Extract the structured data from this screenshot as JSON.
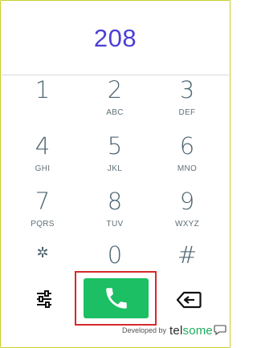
{
  "display": {
    "number": "208"
  },
  "keys": [
    {
      "digit": "1",
      "letters": ""
    },
    {
      "digit": "2",
      "letters": "ABC"
    },
    {
      "digit": "3",
      "letters": "DEF"
    },
    {
      "digit": "4",
      "letters": "GHI"
    },
    {
      "digit": "5",
      "letters": "JKL"
    },
    {
      "digit": "6",
      "letters": "MNO"
    },
    {
      "digit": "7",
      "letters": "PQRS"
    },
    {
      "digit": "8",
      "letters": "TUV"
    },
    {
      "digit": "9",
      "letters": "WXYZ"
    },
    {
      "digit": "✲",
      "letters": ""
    },
    {
      "digit": "0",
      "letters": ""
    },
    {
      "digit": "#",
      "letters": ""
    }
  ],
  "controls": {
    "settings_icon": "sliders-icon",
    "call_icon": "phone-icon",
    "backspace_icon": "backspace-icon"
  },
  "footer": {
    "developed_by": "Developed by",
    "brand_part1": "tel",
    "brand_part2": "some"
  },
  "colors": {
    "accent_number": "#4b3fd6",
    "call_green": "#1cbf63",
    "highlight_red": "#d42a2a",
    "frame_border": "#c8cf2a"
  }
}
